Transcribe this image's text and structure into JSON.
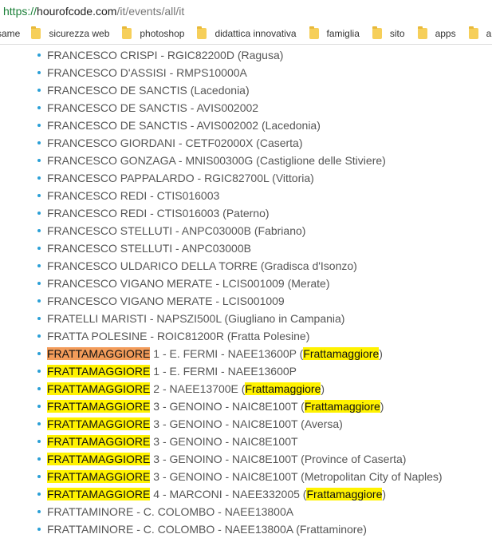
{
  "address_bar": {
    "scheme": "https://",
    "host": "hourofcode.com",
    "path": "/it/events/all/it"
  },
  "bookmarks": {
    "first_label": "same",
    "items": [
      {
        "label": "sicurezza web",
        "icon": "folder-icon"
      },
      {
        "label": "photoshop",
        "icon": "folder-icon"
      },
      {
        "label": "didattica innovativa",
        "icon": "folder-icon"
      },
      {
        "label": "famiglia",
        "icon": "folder-icon"
      },
      {
        "label": "sito",
        "icon": "folder-icon"
      },
      {
        "label": "apps",
        "icon": "folder-icon"
      },
      {
        "label": "art",
        "icon": "folder-icon"
      }
    ]
  },
  "colors": {
    "bullet": "#2a9fd6",
    "highlight_yellow": "#fff200",
    "highlight_orange": "#f39c5a",
    "url_scheme": "#1a7f37"
  },
  "search_term": "Frattamaggiore",
  "events": [
    {
      "text": "FRANCESCO CRISPI - RGIC82200D (Ragusa)"
    },
    {
      "text": "FRANCESCO D'ASSISI - RMPS10000A"
    },
    {
      "text": "FRANCESCO DE SANCTIS (Lacedonia)"
    },
    {
      "text": "FRANCESCO DE SANCTIS - AVIS002002"
    },
    {
      "text": "FRANCESCO DE SANCTIS - AVIS002002 (Lacedonia)"
    },
    {
      "text": "FRANCESCO GIORDANI - CETF02000X (Caserta)"
    },
    {
      "text": "FRANCESCO GONZAGA - MNIS00300G (Castiglione delle Stiviere)"
    },
    {
      "text": "FRANCESCO PAPPALARDO - RGIC82700L (Vittoria)"
    },
    {
      "text": "FRANCESCO REDI - CTIS016003"
    },
    {
      "text": "FRANCESCO REDI - CTIS016003 (Paterno)"
    },
    {
      "text": "FRANCESCO STELLUTI - ANPC03000B (Fabriano)"
    },
    {
      "text": "FRANCESCO STELLUTI - ANPC03000B"
    },
    {
      "text": "FRANCESCO ULDARICO DELLA TORRE (Gradisca d'Isonzo)"
    },
    {
      "text": "FRANCESCO VIGANO MERATE - LCIS001009 (Merate)"
    },
    {
      "text": "FRANCESCO VIGANO MERATE - LCIS001009"
    },
    {
      "text": "FRATELLI MARISTI - NAPSZI500L (Giugliano in Campania)"
    },
    {
      "text": "FRATTA POLESINE - ROIC81200R (Fratta Polesine)"
    },
    {
      "name_hl": "FRATTAMAGGIORE",
      "hl_style": "orange",
      "rest": " 1 - E. FERMI - NAEE13600P (",
      "city_hl": "Frattamaggiore",
      "tail": ")"
    },
    {
      "name_hl": "FRATTAMAGGIORE",
      "hl_style": "yellow",
      "rest": " 1 - E. FERMI - NAEE13600P"
    },
    {
      "name_hl": "FRATTAMAGGIORE",
      "hl_style": "yellow",
      "rest": " 2 - NAEE13700E (",
      "city_hl": "Frattamaggiore",
      "tail": ")"
    },
    {
      "name_hl": "FRATTAMAGGIORE",
      "hl_style": "yellow",
      "rest": " 3 - GENOINO - NAIC8E100T (",
      "city_hl": "Frattamaggiore",
      "tail": ")"
    },
    {
      "name_hl": "FRATTAMAGGIORE",
      "hl_style": "yellow",
      "rest": " 3 - GENOINO - NAIC8E100T (Aversa)"
    },
    {
      "name_hl": "FRATTAMAGGIORE",
      "hl_style": "yellow",
      "rest": " 3 - GENOINO - NAIC8E100T"
    },
    {
      "name_hl": "FRATTAMAGGIORE",
      "hl_style": "yellow",
      "rest": " 3 - GENOINO - NAIC8E100T (Province of Caserta)"
    },
    {
      "name_hl": "FRATTAMAGGIORE",
      "hl_style": "yellow",
      "rest": " 3 - GENOINO - NAIC8E100T (Metropolitan City of Naples)"
    },
    {
      "name_hl": "FRATTAMAGGIORE",
      "hl_style": "yellow",
      "rest": " 4 - MARCONI - NAEE332005 (",
      "city_hl": "Frattamaggiore",
      "tail": ")"
    },
    {
      "text": "FRATTAMINORE - C. COLOMBO - NAEE13800A"
    },
    {
      "text": "FRATTAMINORE - C. COLOMBO - NAEE13800A (Frattaminore)"
    }
  ]
}
